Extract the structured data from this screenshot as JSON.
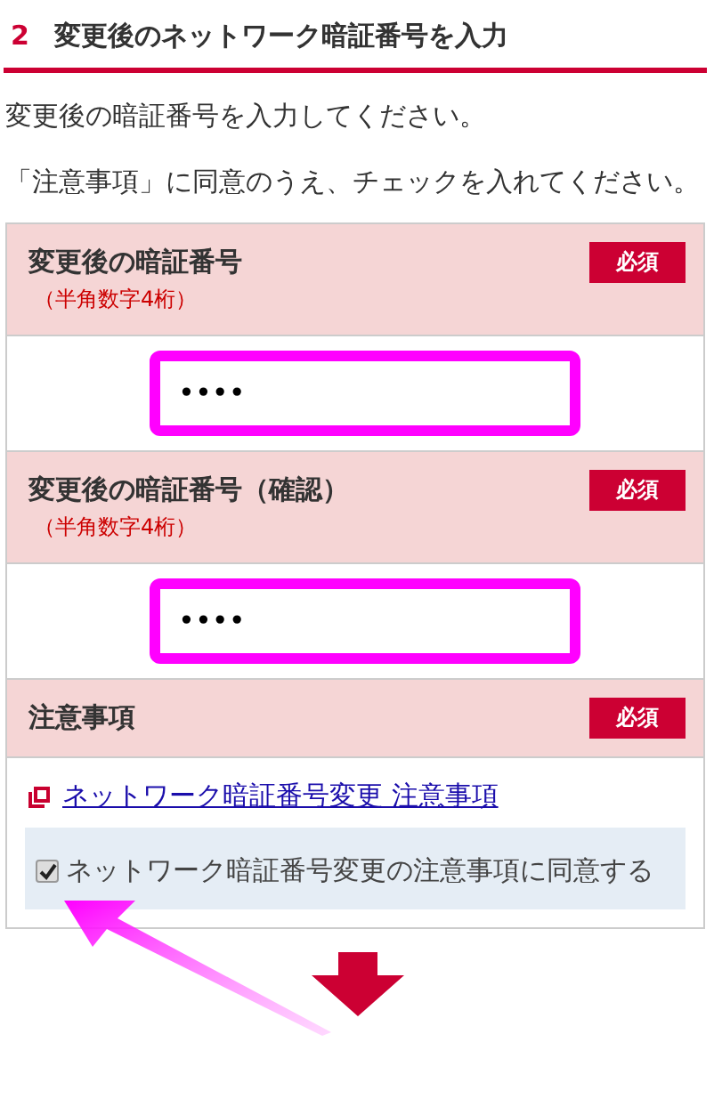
{
  "section": {
    "number": "2",
    "title": "変更後のネットワーク暗証番号を入力"
  },
  "instructions": [
    "変更後の暗証番号を入力してください。",
    "「注意事項」に同意のうえ、チェックを入れてください。"
  ],
  "fields": [
    {
      "kind": "password",
      "label": "変更後の暗証番号",
      "note": "（半角数字4桁）",
      "badge": "必須",
      "value": "••••",
      "highlighted": true
    },
    {
      "kind": "password",
      "label": "変更後の暗証番号（確認）",
      "note": "（半角数字4桁）",
      "badge": "必須",
      "value": "••••",
      "highlighted": true
    },
    {
      "kind": "agreement",
      "label": "注意事項",
      "badge": "必須",
      "link": "ネットワーク暗証番号変更 注意事項",
      "checkbox": {
        "label": "ネットワーク暗証番号変更の注意事項に同意する",
        "checked": true
      }
    }
  ]
}
